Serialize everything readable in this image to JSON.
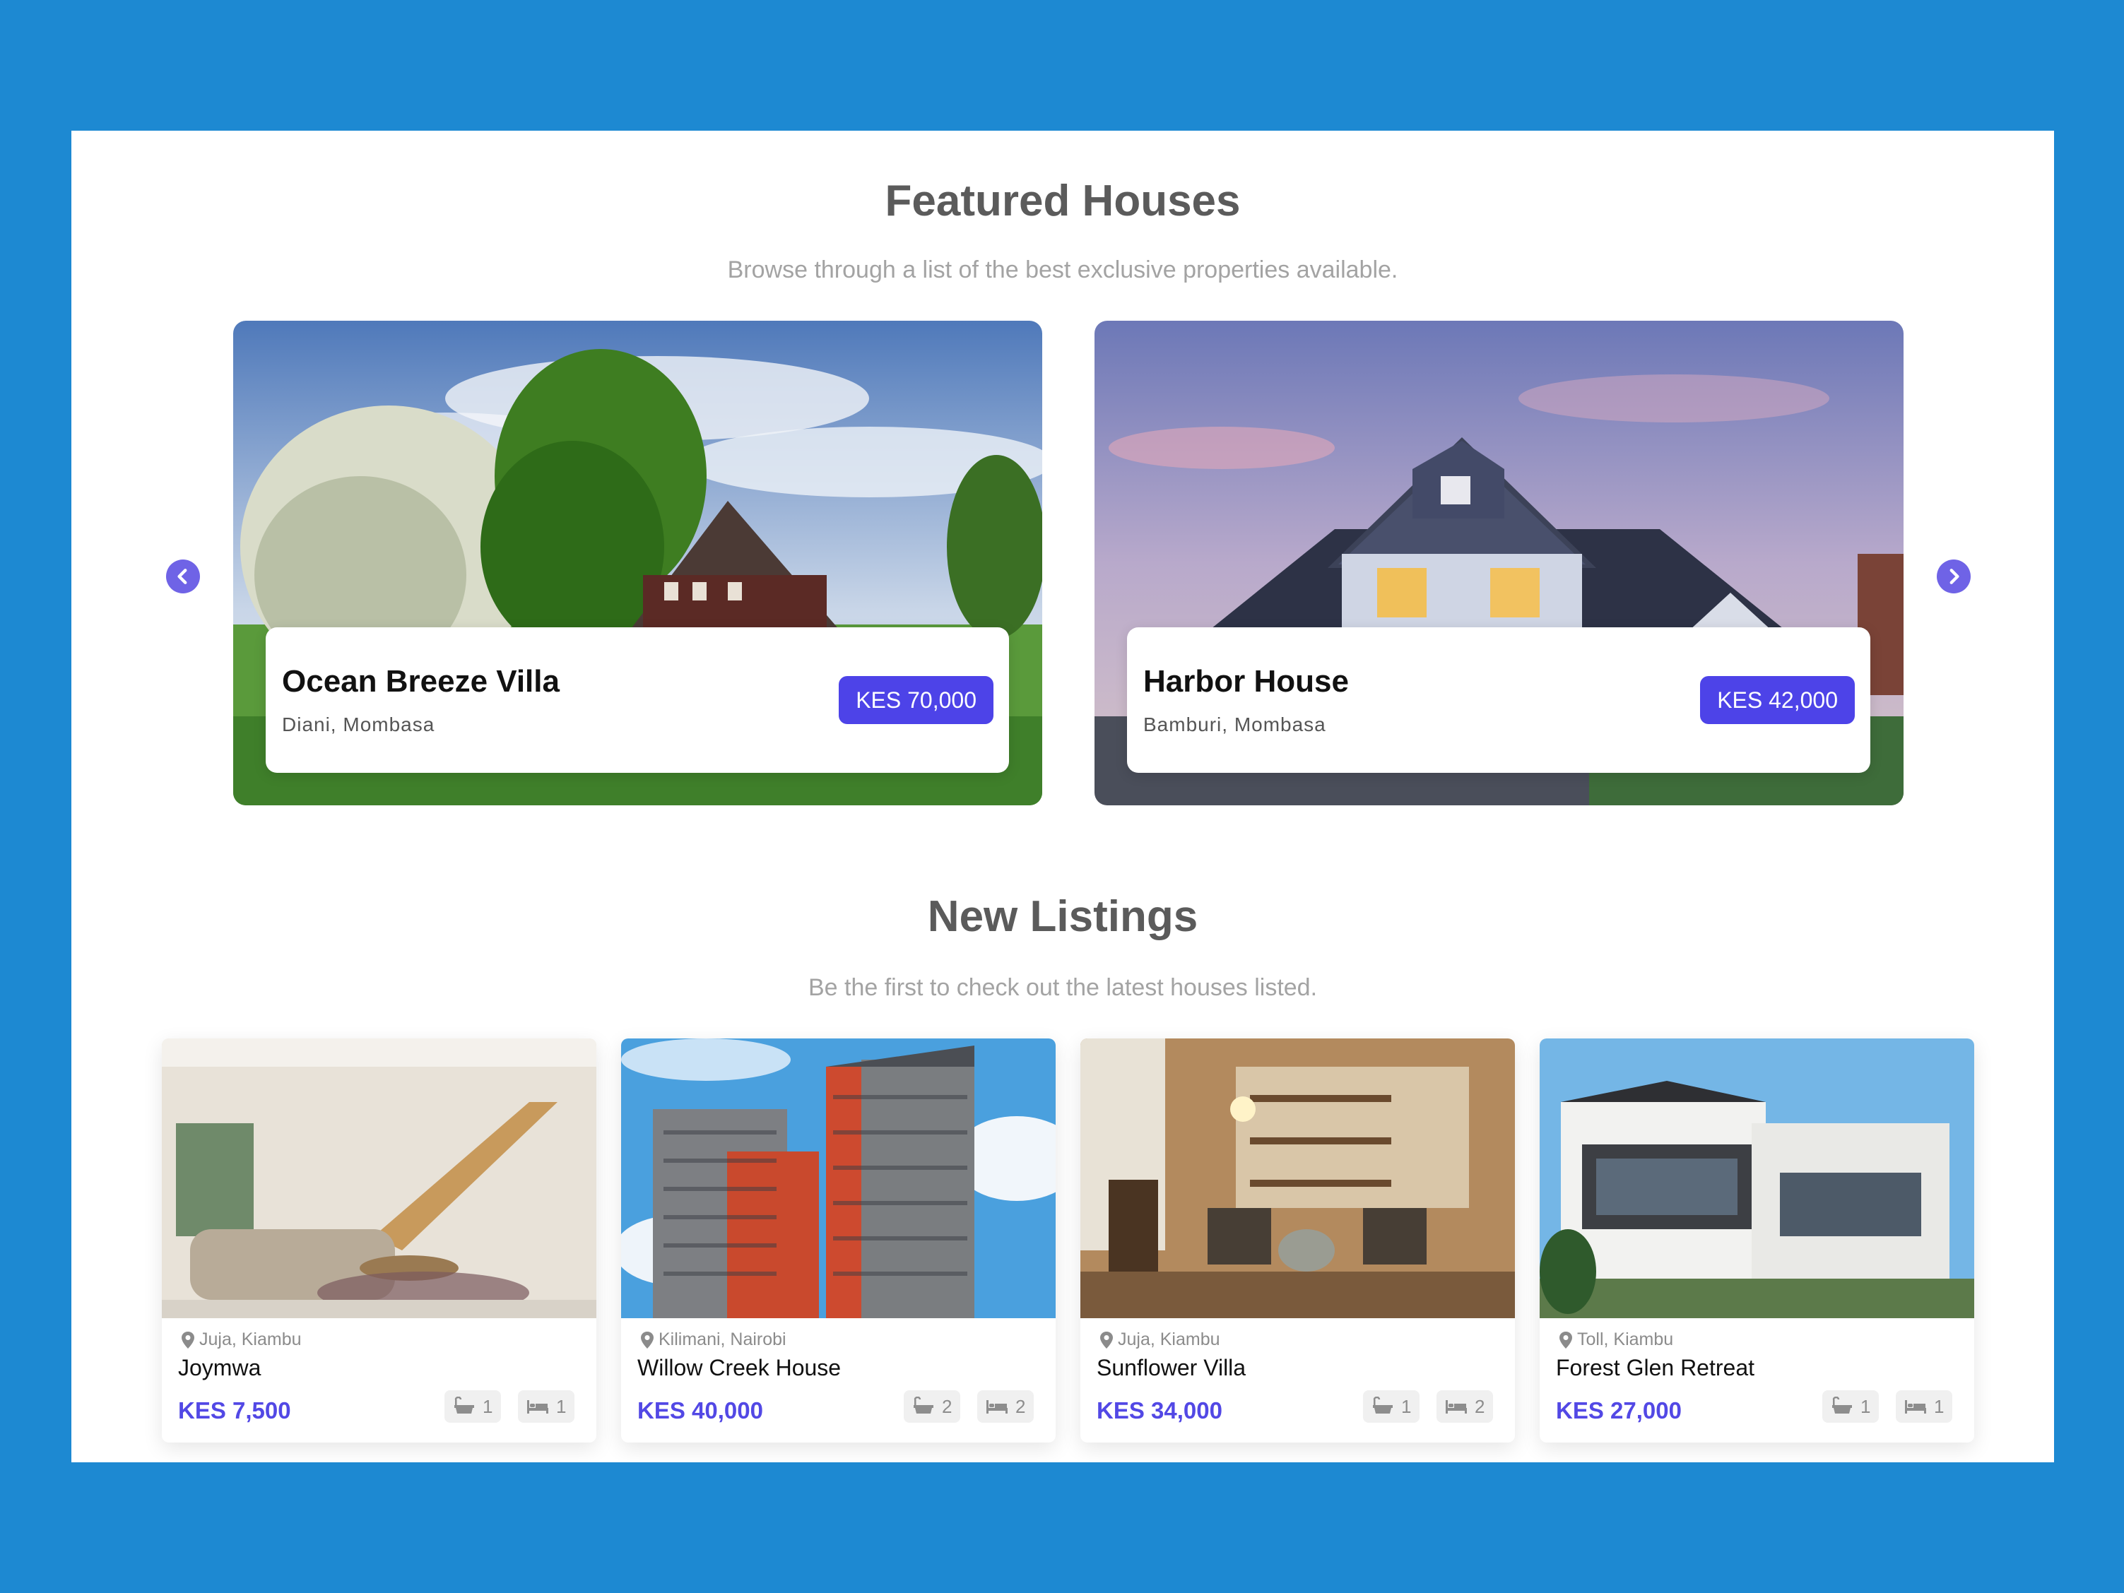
{
  "featured": {
    "heading": "Featured Houses",
    "subheading": "Browse through a list of the best exclusive properties available.",
    "prev_icon": "chevron-left-icon",
    "next_icon": "chevron-right-icon",
    "items": [
      {
        "title": "Ocean Breeze Villa",
        "location": "Diani, Mombasa",
        "price": "KES 70,000"
      },
      {
        "title": "Harbor House",
        "location": "Bamburi, Mombasa",
        "price": "KES 42,000"
      }
    ]
  },
  "listings": {
    "heading": "New Listings",
    "subheading": "Be the first to check out the latest houses listed.",
    "items": [
      {
        "location": "Juja, Kiambu",
        "title": "Joymwa",
        "price": "KES 7,500",
        "baths": "1",
        "beds": "1"
      },
      {
        "location": "Kilimani, Nairobi",
        "title": "Willow Creek House",
        "price": "KES 40,000",
        "baths": "2",
        "beds": "2"
      },
      {
        "location": "Juja, Kiambu",
        "title": "Sunflower Villa",
        "price": "KES 34,000",
        "baths": "1",
        "beds": "2"
      },
      {
        "location": "Toll, Kiambu",
        "title": "Forest Glen Retreat",
        "price": "KES 27,000",
        "baths": "1",
        "beds": "1"
      }
    ]
  },
  "colors": {
    "frame": "#1d89d2",
    "accent": "#4d43e8",
    "price_text": "#5248e5",
    "arrow": "#6f63e6"
  }
}
